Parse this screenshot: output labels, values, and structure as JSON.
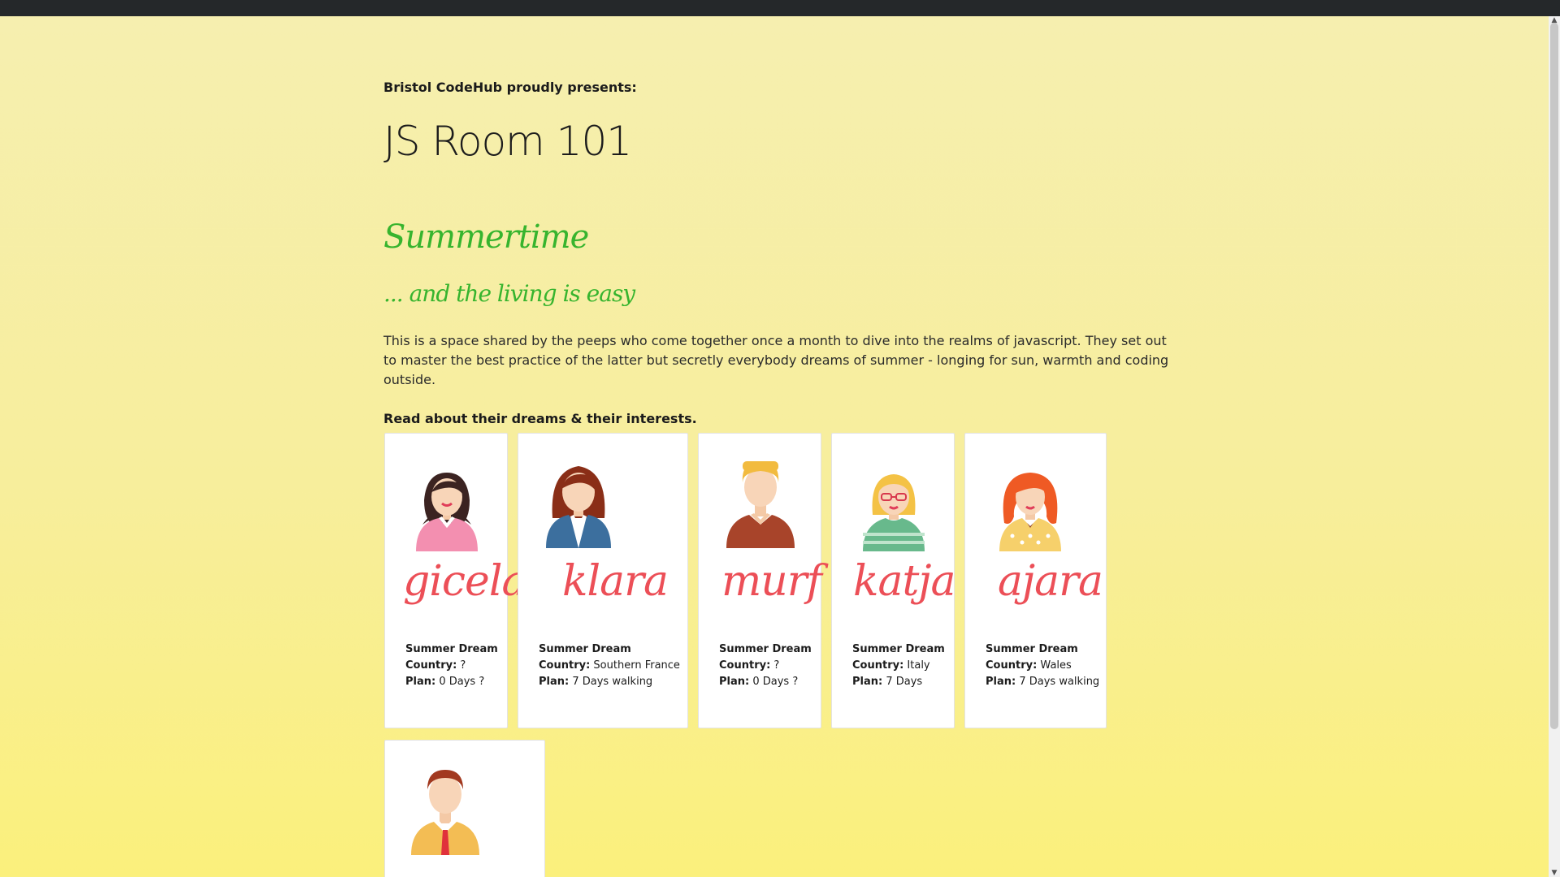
{
  "header": {
    "presents": "Bristol CodeHub proudly presents:",
    "title": "JS Room 101"
  },
  "hero": {
    "script_title": "Summertime",
    "script_subtitle": "... and the living is easy"
  },
  "intro": {
    "text": "This is a space shared by the peeps who come together once a month to dive into the realms of javascript. They set out to master the best practice of the latter but secretly everybody dreams of summer - longing for sun, warmth and coding outside.",
    "read_about": "Read about their dreams & their interests."
  },
  "labels": {
    "summer_dream": "Summer Dream",
    "country": "Country:",
    "plan": "Plan:"
  },
  "cards": [
    {
      "name": "gicela",
      "country": "?",
      "plan": "0 Days ?",
      "avatar": "woman-pink-top-avatar"
    },
    {
      "name": "klara",
      "country": "Southern France",
      "plan": "7 Days walking",
      "avatar": "woman-blue-jacket-avatar"
    },
    {
      "name": "murf",
      "country": "?",
      "plan": "0 Days ?",
      "avatar": "man-blond-avatar"
    },
    {
      "name": "katja",
      "country": "Italy",
      "plan": "7 Days",
      "avatar": "woman-glasses-avatar"
    },
    {
      "name": "ajara",
      "country": "Wales",
      "plan": "7 Days walking",
      "avatar": "woman-red-hair-avatar"
    },
    {
      "name": "",
      "avatar": "man-tie-avatar"
    }
  ],
  "colors": {
    "topbar": "#25282a",
    "script_green": "#37b42e",
    "name_red": "#ec4f57"
  }
}
